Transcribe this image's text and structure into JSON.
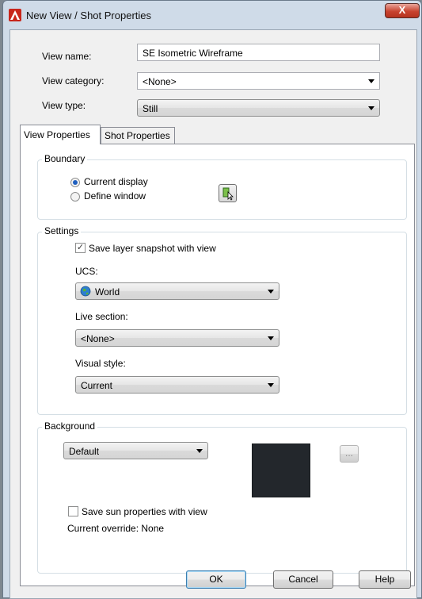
{
  "window": {
    "title": "New View / Shot Properties",
    "close_label": "X"
  },
  "view_name": {
    "label": "View name:",
    "value": "SE Isometric Wireframe"
  },
  "view_category": {
    "label": "View category:",
    "value": "<None>"
  },
  "view_type": {
    "label": "View type:",
    "value": "Still"
  },
  "tabs": [
    {
      "label": "View Properties"
    },
    {
      "label": "Shot Properties"
    }
  ],
  "boundary": {
    "title": "Boundary",
    "options": [
      {
        "label": "Current display",
        "selected": true
      },
      {
        "label": "Define window",
        "selected": false
      }
    ]
  },
  "settings": {
    "title": "Settings",
    "save_layer_label": "Save layer snapshot with view",
    "save_layer_checked": true,
    "ucs_label": "UCS:",
    "ucs_value": "World",
    "live_section_label": "Live section:",
    "live_section_value": "<None>",
    "visual_style_label": "Visual style:",
    "visual_style_value": "Current"
  },
  "background": {
    "title": "Background",
    "value": "Default",
    "swatch_color": "#23272c",
    "browse_label": "...",
    "save_sun_label": "Save sun properties with view",
    "save_sun_checked": false,
    "override_text": "Current override: None"
  },
  "buttons": {
    "ok": "OK",
    "cancel": "Cancel",
    "help": "Help"
  },
  "colors": {
    "accent": "#1f5fbf",
    "app_icon": "#c8261b"
  }
}
